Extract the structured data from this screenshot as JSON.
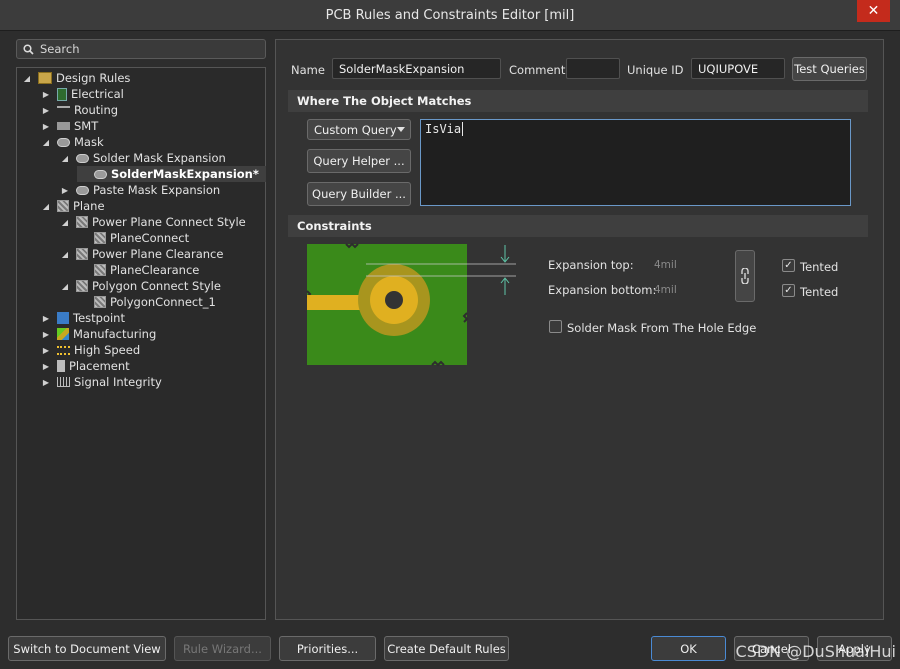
{
  "window": {
    "title": "PCB Rules and Constraints Editor [mil]",
    "close_glyph": "✕"
  },
  "search": {
    "placeholder": "Search"
  },
  "tree": [
    {
      "label": "Design Rules",
      "icon": "design-rules-icon"
    },
    {
      "label": "Electrical",
      "icon": "electrical-icon"
    },
    {
      "label": "Routing",
      "icon": "routing-icon"
    },
    {
      "label": "SMT",
      "icon": "smt-icon"
    },
    {
      "label": "Mask",
      "icon": "mask-icon"
    },
    {
      "label": "Solder Mask Expansion",
      "icon": "mask-rule-icon"
    },
    {
      "label": "SolderMaskExpansion*",
      "icon": "mask-rule-icon"
    },
    {
      "label": "Paste Mask Expansion",
      "icon": "mask-rule-icon"
    },
    {
      "label": "Plane",
      "icon": "plane-icon"
    },
    {
      "label": "Power Plane Connect Style",
      "icon": "plane-rule-icon"
    },
    {
      "label": "PlaneConnect",
      "icon": "plane-rule-icon"
    },
    {
      "label": "Power Plane Clearance",
      "icon": "plane-rule-icon"
    },
    {
      "label": "PlaneClearance",
      "icon": "plane-rule-icon"
    },
    {
      "label": "Polygon Connect Style",
      "icon": "plane-rule-icon"
    },
    {
      "label": "PolygonConnect_1",
      "icon": "plane-rule-icon"
    },
    {
      "label": "Testpoint",
      "icon": "testpoint-icon"
    },
    {
      "label": "Manufacturing",
      "icon": "manufacturing-icon"
    },
    {
      "label": "High Speed",
      "icon": "high-speed-icon"
    },
    {
      "label": "Placement",
      "icon": "placement-icon"
    },
    {
      "label": "Signal Integrity",
      "icon": "signal-integrity-icon"
    }
  ],
  "rule": {
    "name_label": "Name",
    "name_value": "SolderMaskExpansion",
    "comment_label": "Comment",
    "comment_value": "",
    "uid_label": "Unique ID",
    "uid_value": "UQIUPOVE",
    "test_queries": "Test Queries"
  },
  "where": {
    "header": "Where The Object Matches",
    "dropdown_value": "Custom Query",
    "query_helper": "Query Helper ...",
    "query_builder": "Query Builder ...",
    "query_text": "IsVia"
  },
  "constraints": {
    "header": "Constraints",
    "expansion_top_label": "Expansion top:",
    "expansion_top_value": "4mil",
    "expansion_bottom_label": "Expansion bottom:",
    "expansion_bottom_value": "4mil",
    "tented_top": "Tented",
    "tented_bottom": "Tented",
    "tented_top_checked": true,
    "tented_bottom_checked": true,
    "hole_edge_label": "Solder Mask From The Hole Edge",
    "hole_edge_checked": false,
    "check_glyph": "✓",
    "colors": {
      "board": "#3a8a1a",
      "pad": "#e0b020",
      "mask_ring": "#a8951e",
      "hole": "#333333"
    }
  },
  "footer": {
    "switch_view": "Switch to Document View",
    "rule_wizard": "Rule Wizard...",
    "priorities": "Priorities...",
    "create_default": "Create Default Rules",
    "ok": "OK",
    "cancel": "Cancel",
    "apply": "Apply"
  },
  "watermark": "CSDN @DuShuaiHui"
}
